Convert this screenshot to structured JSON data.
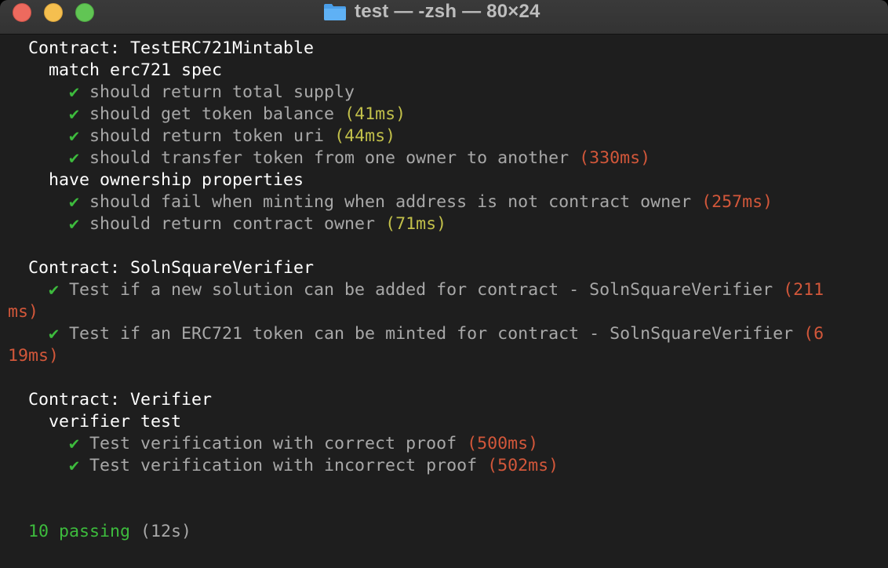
{
  "window": {
    "title": "test — -zsh — 80×24"
  },
  "icons": {
    "title_icon": "folder-icon",
    "check_icon": "checkmark-icon"
  },
  "colors": {
    "background": "#1e1e1e",
    "check": "#3dbb3d",
    "medium_duration": "#c2c04a",
    "slow_duration": "#d2573a"
  },
  "terminal": {
    "check_glyph": "✔",
    "lines": {
      "l1": {
        "label": "Contract: TestERC721Mintable"
      },
      "l2": {
        "label": "match erc721 spec"
      },
      "l3": {
        "text": "should return total supply"
      },
      "l4": {
        "text": "should get token balance",
        "duration": "(41ms)"
      },
      "l5": {
        "text": "should return token uri",
        "duration": "(44ms)"
      },
      "l6": {
        "text": "should transfer token from one owner to another",
        "duration": "(330ms)"
      },
      "l7": {
        "label": "have ownership properties"
      },
      "l8": {
        "text": "should fail when minting when address is not contract owner",
        "duration": "(257ms)"
      },
      "l9": {
        "text": "should return contract owner",
        "duration": "(71ms)"
      },
      "l11": {
        "label": "Contract: SolnSquareVerifier"
      },
      "l12": {
        "text": "Test if a new solution can be added for contract - SolnSquareVerifier",
        "duration_part1": "(211"
      },
      "l13": {
        "duration_part2": "ms)"
      },
      "l14": {
        "text": "Test if an ERC721 token can be minted for contract - SolnSquareVerifier",
        "duration_part1": "(6"
      },
      "l15": {
        "duration_part2": "19ms)"
      },
      "l17": {
        "label": "Contract: Verifier"
      },
      "l18": {
        "label": "verifier test"
      },
      "l19": {
        "text": "Test verification with correct proof",
        "duration": "(500ms)"
      },
      "l20": {
        "text": "Test verification with incorrect proof",
        "duration": "(502ms)"
      },
      "l23": {
        "passing": "10 passing",
        "time": "(12s)"
      }
    }
  }
}
